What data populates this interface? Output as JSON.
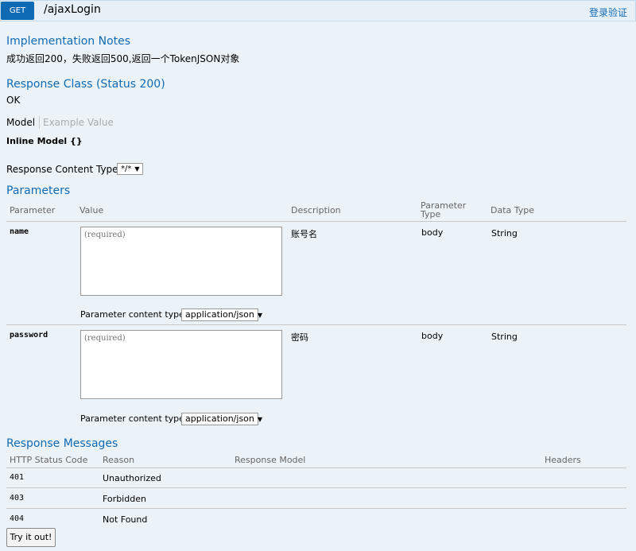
{
  "header": {
    "method": "GET",
    "path": "/ajaxLogin",
    "auth_link": "登录验证"
  },
  "implementation_notes": {
    "title": "Implementation Notes",
    "text": "成功返回200，失败返回500,返回一个TokenJSON对象"
  },
  "response_class": {
    "title": "Response Class (Status 200)",
    "value": "OK",
    "tabs": [
      "Model",
      "Example Value"
    ],
    "model_name": "Inline Model {}"
  },
  "response_content_type": {
    "label": "Response Content Type",
    "selected": "*/*"
  },
  "parameters": {
    "title": "Parameters",
    "headers": [
      "Parameter",
      "Value",
      "Description",
      "Parameter Type",
      "Data Type"
    ],
    "content_type_label": "Parameter content type:",
    "rows": [
      {
        "name": "name",
        "placeholder": "(required)",
        "description": "账号名",
        "type": "body",
        "data_type": "String",
        "content_type": "application/json"
      },
      {
        "name": "password",
        "placeholder": "(required)",
        "description": "密码",
        "type": "body",
        "data_type": "String",
        "content_type": "application/json"
      }
    ]
  },
  "response_messages": {
    "title": "Response Messages",
    "headers": [
      "HTTP Status Code",
      "Reason",
      "Response Model",
      "Headers"
    ],
    "rows": [
      {
        "code": "401",
        "reason": "Unauthorized"
      },
      {
        "code": "403",
        "reason": "Forbidden"
      },
      {
        "code": "404",
        "reason": "Not Found"
      }
    ]
  },
  "try_button": "Try it out!"
}
